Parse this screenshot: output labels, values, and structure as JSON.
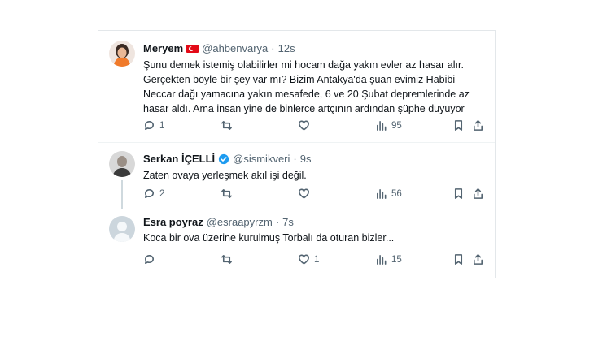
{
  "tweets": [
    {
      "name": "Meryem",
      "has_flag": true,
      "handle": "@ahbenvarya",
      "dot": "·",
      "time": "12s",
      "lines": [
        "Şunu demek istemiş olabilirler mi hocam dağa yakın evler az hasar alır.",
        "Gerçekten böyle bir şey var mı? Bizim Antakya'da şuan evimiz Habibi",
        "Neccar dağı yamacına yakın mesafede, 6 ve 20 Şubat depremlerinde az",
        "hasar aldı. Ama insan yine de binlerce artçının ardından şüphe duyuyor"
      ],
      "replies": "1",
      "retweets": "",
      "likes": "",
      "views": "95"
    },
    {
      "name": "Serkan İÇELLİ",
      "verified": true,
      "handle": "@sismikveri",
      "dot": "·",
      "time": "9s",
      "lines": [
        "Zaten ovaya yerleşmek akıl işi değil."
      ],
      "replies": "2",
      "retweets": "",
      "likes": "",
      "views": "56"
    },
    {
      "name": "Esra poyraz",
      "handle": "@esraapyrzm",
      "dot": "·",
      "time": "7s",
      "lines": [
        "Koca bir ova üzerine kurulmuş Torbalı da oturan bizler..."
      ],
      "replies": "",
      "retweets": "",
      "likes": "1",
      "views": "15"
    }
  ],
  "colors": {
    "text": "#0f1419",
    "muted": "#536471",
    "verified": "#1d9bf0",
    "flag": "#e30a17"
  },
  "icons": [
    "reply-icon",
    "retweet-icon",
    "like-icon",
    "views-icon",
    "bookmark-icon",
    "share-icon",
    "verified-badge-icon",
    "turkey-flag-icon"
  ]
}
